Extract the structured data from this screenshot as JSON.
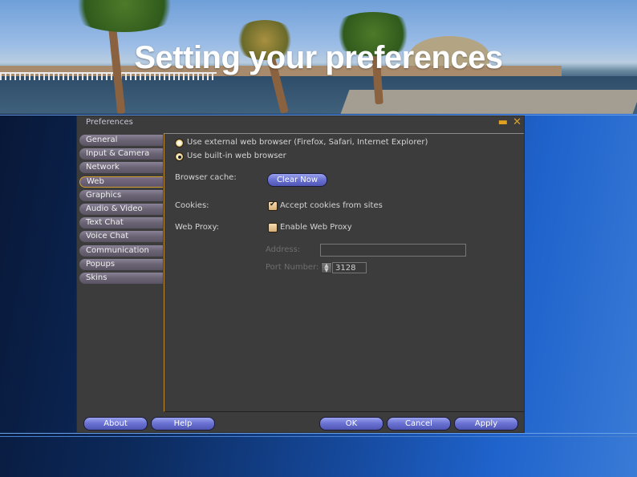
{
  "slide": {
    "title": "Setting your preferences"
  },
  "window": {
    "title": "Preferences",
    "minimize_icon": "minimize-icon",
    "close_icon": "close-icon"
  },
  "tabs": [
    {
      "label": "General",
      "active": false
    },
    {
      "label": "Input & Camera",
      "active": false
    },
    {
      "label": "Network",
      "active": false
    },
    {
      "label": "Web",
      "active": true
    },
    {
      "label": "Graphics",
      "active": false
    },
    {
      "label": "Audio & Video",
      "active": false
    },
    {
      "label": "Text Chat",
      "active": false
    },
    {
      "label": "Voice Chat",
      "active": false
    },
    {
      "label": "Communication",
      "active": false
    },
    {
      "label": "Popups",
      "active": false
    },
    {
      "label": "Skins",
      "active": false
    }
  ],
  "web": {
    "browser_options": [
      {
        "label": "Use external web browser (Firefox, Safari, Internet Explorer)",
        "selected": false
      },
      {
        "label": "Use built-in web browser",
        "selected": true
      }
    ],
    "browser_cache_label": "Browser cache:",
    "clear_now_label": "Clear Now",
    "cookies_label": "Cookies:",
    "accept_cookies_label": "Accept cookies from sites",
    "accept_cookies_checked": true,
    "web_proxy_label": "Web Proxy:",
    "enable_proxy_label": "Enable Web Proxy",
    "enable_proxy_checked": false,
    "address_label": "Address:",
    "address_value": "",
    "port_label": "Port Number:",
    "port_value": "3128"
  },
  "footer": {
    "about": "About",
    "help": "Help",
    "ok": "OK",
    "cancel": "Cancel",
    "apply": "Apply"
  }
}
